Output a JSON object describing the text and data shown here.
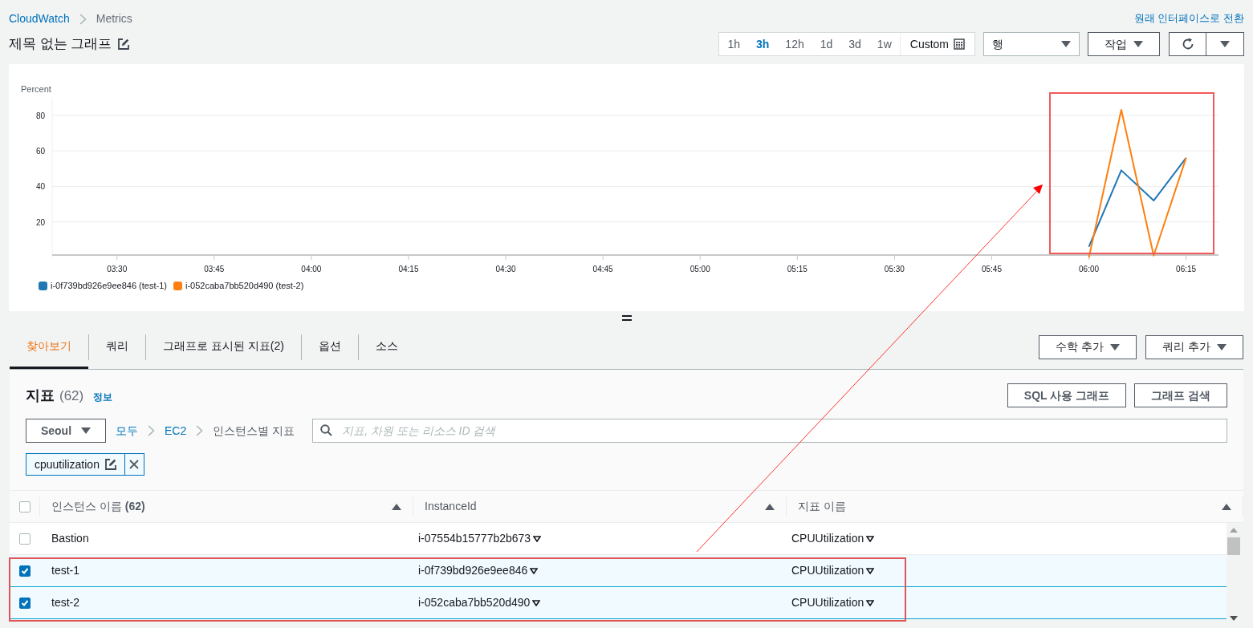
{
  "breadcrumb": [
    {
      "label": "CloudWatch",
      "link": true
    },
    {
      "label": "Metrics",
      "link": false
    }
  ],
  "switch_link": "원래 인터페이스로 전환",
  "graph_title": "제목 없는 그래프",
  "time_ranges": [
    {
      "label": "1h",
      "selected": false
    },
    {
      "label": "3h",
      "selected": true
    },
    {
      "label": "12h",
      "selected": false
    },
    {
      "label": "1d",
      "selected": false
    },
    {
      "label": "3d",
      "selected": false
    },
    {
      "label": "1w",
      "selected": false
    },
    {
      "label": "Custom",
      "selected": false
    }
  ],
  "view_select": {
    "value": "행"
  },
  "actions_button": "작업",
  "chart": {
    "chart_data": {
      "type": "line",
      "ylabel": "Percent",
      "x": [
        360,
        365,
        370,
        375
      ],
      "xlim": [
        200,
        380
      ],
      "ylim": [
        0,
        90
      ],
      "grid": true,
      "legend": "bottom",
      "xticks": [
        {
          "value": 210,
          "label": "03:30"
        },
        {
          "value": 225,
          "label": "03:45"
        },
        {
          "value": 240,
          "label": "04:00"
        },
        {
          "value": 255,
          "label": "04:15"
        },
        {
          "value": 270,
          "label": "04:30"
        },
        {
          "value": 285,
          "label": "04:45"
        },
        {
          "value": 300,
          "label": "05:00"
        },
        {
          "value": 315,
          "label": "05:15"
        },
        {
          "value": 330,
          "label": "05:30"
        },
        {
          "value": 345,
          "label": "05:45"
        },
        {
          "value": 360,
          "label": "06:00"
        },
        {
          "value": 375,
          "label": "06:15"
        }
      ],
      "yticks": [
        20,
        40,
        60,
        80
      ],
      "series": [
        {
          "name": "i-0f739bd926e9ee846 (test-1)",
          "color": "#1f77b4",
          "values": [
            6,
            49,
            32,
            56
          ]
        },
        {
          "name": "i-052caba7bb520d490 (test-2)",
          "color": "#ff7f0e",
          "values": [
            0,
            83,
            1,
            56
          ]
        }
      ]
    }
  },
  "tabs": [
    {
      "label": "찾아보기",
      "selected": true
    },
    {
      "label": "쿼리",
      "selected": false
    },
    {
      "label": "그래프로 표시된 지표(2)",
      "selected": false
    },
    {
      "label": "옵션",
      "selected": false
    },
    {
      "label": "소스",
      "selected": false
    }
  ],
  "math_button": "수학 추가",
  "query_button": "쿼리 추가",
  "metrics": {
    "title": "지표",
    "count": "(62)",
    "info_link": "정보",
    "sql_button": "SQL 사용 그래프",
    "search_button": "그래프 검색",
    "region": "Seoul",
    "path": [
      {
        "label": "모두",
        "link": true
      },
      {
        "label": "EC2",
        "link": true
      },
      {
        "label": "인스턴스별 지표",
        "link": false
      }
    ],
    "search_placeholder": "지표, 차원 또는 리소스 ID 검색",
    "filter_token": "cpuutilization"
  },
  "table": {
    "select_all_checked": false,
    "columns": [
      "인스턴스 이름 **(62)**",
      "InstanceId",
      "지표 이름"
    ],
    "rows": [
      {
        "checked": false,
        "cells": [
          "Bastion",
          "i-07554b15777b2b673",
          "CPUUtilization"
        ]
      },
      {
        "checked": true,
        "cells": [
          "test-1",
          "i-0f739bd926e9ee846",
          "CPUUtilization"
        ]
      },
      {
        "checked": true,
        "cells": [
          "test-2",
          "i-052caba7bb520d490",
          "CPUUtilization"
        ]
      }
    ]
  }
}
